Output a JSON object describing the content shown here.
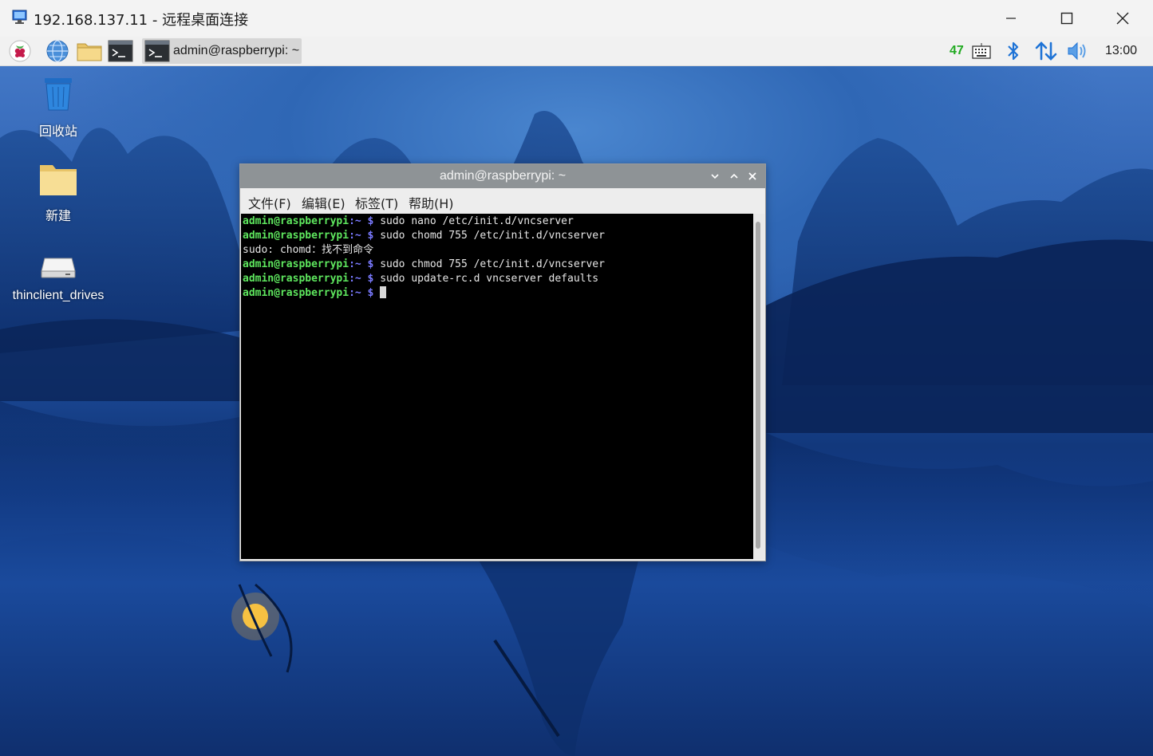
{
  "rdp_window": {
    "title": "192.168.137.11 - 远程桌面连接",
    "controls": {
      "minimize": "minimize-icon",
      "maximize": "maximize-icon",
      "close": "close-icon"
    }
  },
  "panel": {
    "launchers": [
      "raspberry-menu-icon",
      "web-browser-icon",
      "file-manager-icon",
      "terminal-icon"
    ],
    "task": {
      "label": "admin@raspberrypi: ~",
      "icon": "terminal-icon"
    },
    "tray": {
      "cpu": "47",
      "icons": [
        "keyboard-icon",
        "bluetooth-icon",
        "network-transfer-icon",
        "volume-icon"
      ],
      "clock": "13:00"
    }
  },
  "desktop": {
    "icons": [
      {
        "label": "回收站",
        "icon": "trash-icon"
      },
      {
        "label": "新建",
        "icon": "folder-icon"
      },
      {
        "label": "thinclient_drives",
        "icon": "drive-icon"
      }
    ]
  },
  "terminal": {
    "title": "admin@raspberrypi: ~",
    "menu": [
      "文件(F)",
      "编辑(E)",
      "标签(T)",
      "帮助(H)"
    ],
    "prompt_user": "admin@raspberrypi",
    "prompt_dir": ":~ $",
    "lines": [
      {
        "type": "cmd",
        "text": " sudo nano /etc/init.d/vncserver"
      },
      {
        "type": "cmd",
        "text": " sudo chomd 755 /etc/init.d/vncserver"
      },
      {
        "type": "out",
        "text": "sudo: chomd：找不到命令"
      },
      {
        "type": "cmd",
        "text": " sudo chmod 755 /etc/init.d/vncserver"
      },
      {
        "type": "cmd",
        "text": " sudo update-rc.d vncserver defaults"
      },
      {
        "type": "cmd",
        "text": " "
      }
    ]
  },
  "colors": {
    "prompt_user": "#5ee65e",
    "prompt_dir": "#7a7aff",
    "terminal_bg": "#000000",
    "cpu": "#22aa22",
    "accent": "#1e73d6"
  }
}
